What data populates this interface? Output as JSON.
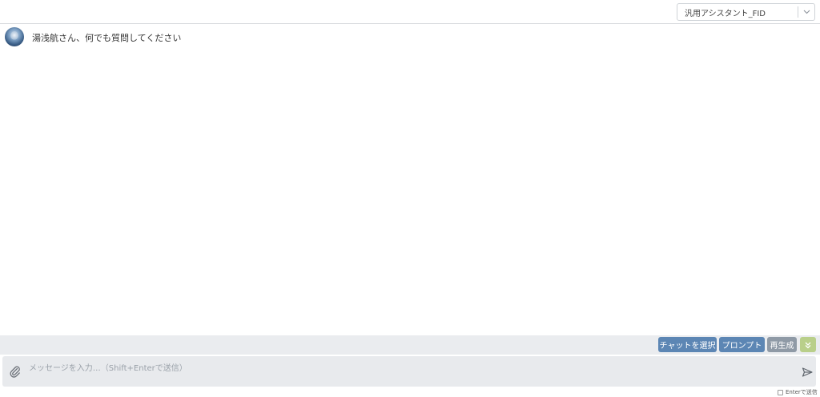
{
  "header": {
    "assistant_select": {
      "value": "汎用アシスタント_FID",
      "icon": "chevron-down-icon"
    }
  },
  "chat": {
    "avatar_icon": "assistant-avatar",
    "greeting": "湯浅航さん、何でも質問してください"
  },
  "actions": {
    "chat_select_label": "チャットを選択",
    "prompt_label": "プロンプト",
    "regenerate_label": "再生成",
    "expand_icon": "double-chevron-down-icon"
  },
  "composer": {
    "attach_icon": "paperclip-icon",
    "placeholder": "メッセージを入力…（Shift+Enterで送信）",
    "value": "",
    "send_icon": "send-icon",
    "enter_send_label": "Enterで送信",
    "enter_send_checked": false
  },
  "colors": {
    "primary_button": "#5c86b4",
    "secondary_button": "#8f9aa6",
    "expand_button": "#b9cf8a",
    "bar_background": "#eaecef"
  }
}
